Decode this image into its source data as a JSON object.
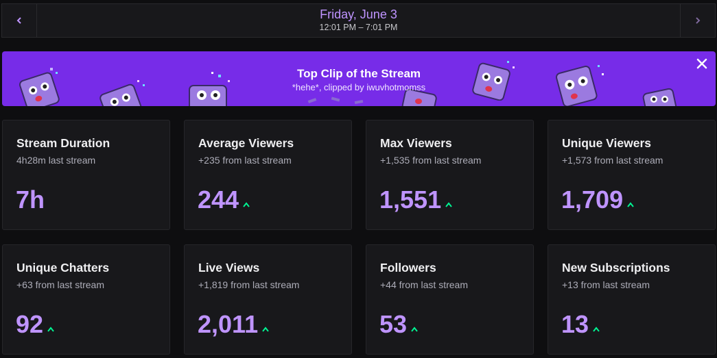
{
  "header": {
    "date": "Friday, June 3",
    "time_range": "12:01 PM – 7:01 PM",
    "prev_icon": "chevron-left-icon",
    "next_icon": "chevron-right-icon"
  },
  "banner": {
    "title": "Top Clip of the Stream",
    "subtitle": "*hehe*, clipped by iwuvhotmomss",
    "close_icon": "close-icon",
    "color": "#772ce8"
  },
  "colors": {
    "accent": "#bf94ff",
    "trend_up": "#00f593"
  },
  "stats": [
    {
      "title": "Stream Duration",
      "sub": "4h28m last stream",
      "value": "7h",
      "trend": false
    },
    {
      "title": "Average Viewers",
      "sub": "+235 from last stream",
      "value": "244",
      "trend": true
    },
    {
      "title": "Max Viewers",
      "sub": "+1,535 from last stream",
      "value": "1,551",
      "trend": true
    },
    {
      "title": "Unique Viewers",
      "sub": "+1,573 from last stream",
      "value": "1,709",
      "trend": true
    },
    {
      "title": "Unique Chatters",
      "sub": "+63 from last stream",
      "value": "92",
      "trend": true
    },
    {
      "title": "Live Views",
      "sub": "+1,819 from last stream",
      "value": "2,011",
      "trend": true
    },
    {
      "title": "Followers",
      "sub": "+44 from last stream",
      "value": "53",
      "trend": true
    },
    {
      "title": "New Subscriptions",
      "sub": "+13 from last stream",
      "value": "13",
      "trend": true
    }
  ]
}
